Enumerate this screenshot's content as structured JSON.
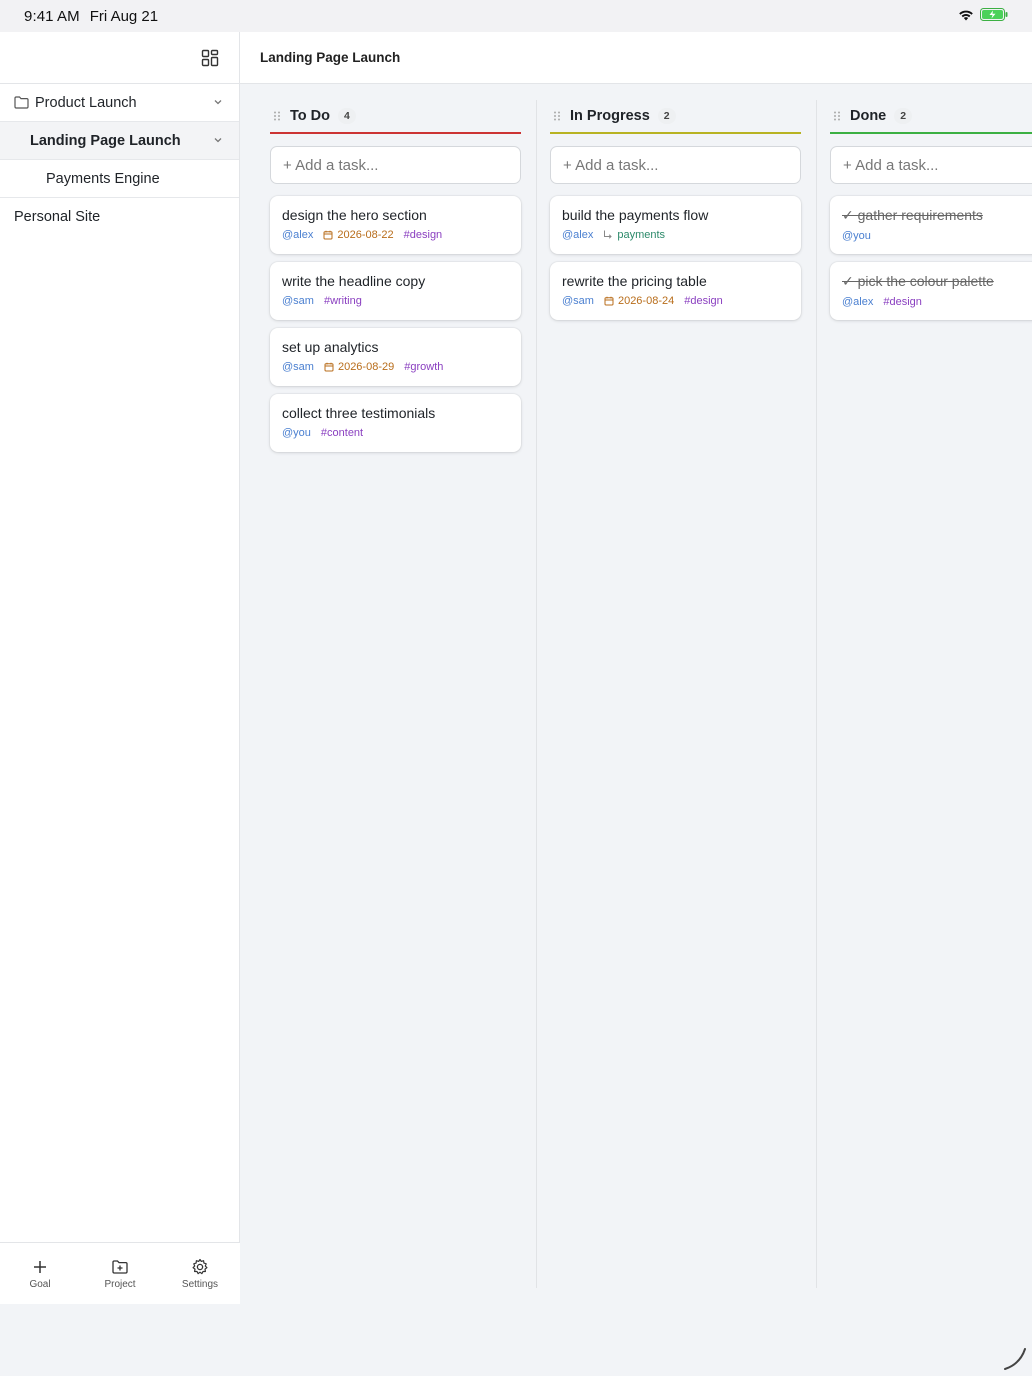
{
  "status_bar": {
    "time": "9:41 AM",
    "date": "Fri Aug 21"
  },
  "header": {
    "title": "Landing Page Launch"
  },
  "sidebar": {
    "goal": {
      "label": "Product Launch"
    },
    "project": {
      "label": "Landing Page Launch"
    },
    "subproject": {
      "label": "Payments Engine"
    },
    "other": {
      "label": "Personal Site"
    }
  },
  "bottom_bar": {
    "goal_label": "Goal",
    "project_label": "Project",
    "settings_label": "Settings"
  },
  "columns": [
    {
      "title": "To Do",
      "count": "4",
      "accent": "#cc3333",
      "add_placeholder": "+ Add a task...",
      "cards": [
        {
          "title": "design the hero section",
          "user": "@alex",
          "date": "2026-08-22",
          "tag": "#design"
        },
        {
          "title": "write the headline copy",
          "user": "@sam",
          "tag": "#writing"
        },
        {
          "title": "set up analytics",
          "user": "@sam",
          "date": "2026-08-29",
          "tag": "#growth"
        },
        {
          "title": "collect three testimonials",
          "user": "@you",
          "tag": "#content"
        }
      ]
    },
    {
      "title": "In Progress",
      "count": "2",
      "accent": "#b8b322",
      "add_placeholder": "+ Add a task...",
      "cards": [
        {
          "title": "build the payments flow",
          "user": "@alex",
          "link": "payments"
        },
        {
          "title": "rewrite the pricing table",
          "user": "@sam",
          "date": "2026-08-24",
          "tag": "#design"
        }
      ]
    },
    {
      "title": "Done",
      "count": "2",
      "accent": "#3cb043",
      "add_placeholder": "+ Add a task...",
      "cards": [
        {
          "title": "✓ gather requirements",
          "user": "@you"
        },
        {
          "title": "✓ pick the colour palette",
          "user": "@alex",
          "tag": "#design"
        }
      ]
    }
  ],
  "icons": {
    "layout": "layout-grid-icon",
    "folder": "folder-icon",
    "chevron": "chevron-down-icon",
    "calendar": "calendar-icon",
    "subtask": "subtask-link-icon",
    "plus": "plus-icon",
    "folder_plus": "folder-plus-icon",
    "settings": "gear-icon"
  }
}
